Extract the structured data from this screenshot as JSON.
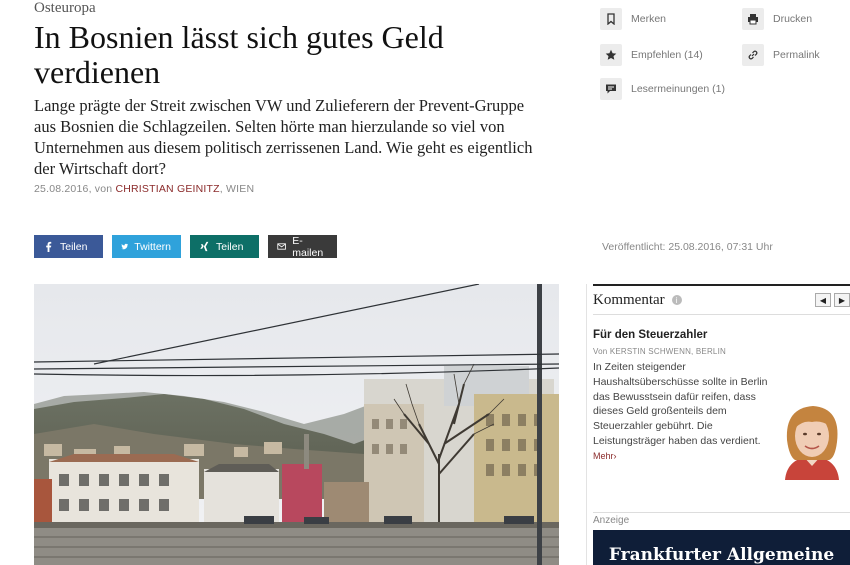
{
  "article": {
    "kicker": "Osteuropa",
    "headline": "In Bosnien lässt sich gutes Geld verdienen",
    "lead": "Lange prägte der Streit zwischen VW und Zulieferern der Prevent-Gruppe aus Bosnien die Schlagzeilen. Selten hörte man hierzulande so viel von Unternehmen aus diesem politisch zerrissenen Land. Wie geht es eigentlich der Wirtschaft dort?",
    "date": "25.08.2016",
    "by_word": ", von ",
    "author": "CHRISTIAN GEINITZ",
    "location": ", WIEN",
    "published": "Veröffentlicht: 25.08.2016, 07:31 Uhr"
  },
  "tools": {
    "merken": "Merken",
    "drucken": "Drucken",
    "empfehlen": "Empfehlen (14)",
    "permalink": "Permalink",
    "lesermeinungen": "Lesermeinungen (1)"
  },
  "share": {
    "facebook": "Teilen",
    "twitter": "Twittern",
    "xing": "Teilen",
    "email": "E-mailen"
  },
  "comment": {
    "section": "Kommentar",
    "info": "i",
    "prev": "◀",
    "next": "▶",
    "title": "Für den Steuerzahler",
    "byline": "Von KERSTIN SCHWENN, BERLIN",
    "text": "In Zeiten steigender Haushaltsüberschüsse sollte in Berlin das Bewusstsein dafür reifen, dass dieses Geld großenteils dem Steuerzahler gebührt. Die Leistungsträger haben das verdient.",
    "more": "Mehr›"
  },
  "ad": {
    "label": "Anzeige",
    "brand": "Frankfurter Allgemeine"
  },
  "colors": {
    "facebook": "#3b5998",
    "twitter": "#2fa2db",
    "xing": "#0d6f67",
    "email": "#3a3a3a",
    "author": "#8b2b2b",
    "ad_bg": "#0f1e38"
  }
}
